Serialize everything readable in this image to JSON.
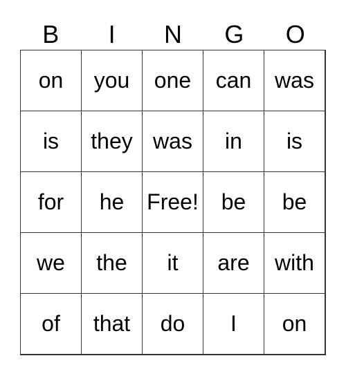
{
  "header": [
    "B",
    "I",
    "N",
    "G",
    "O"
  ],
  "cells": [
    [
      "on",
      "you",
      "one",
      "can",
      "was"
    ],
    [
      "is",
      "they",
      "was",
      "in",
      "is"
    ],
    [
      "for",
      "he",
      "Free!",
      "be",
      "be"
    ],
    [
      "we",
      "the",
      "it",
      "are",
      "with"
    ],
    [
      "of",
      "that",
      "do",
      "I",
      "on"
    ]
  ]
}
